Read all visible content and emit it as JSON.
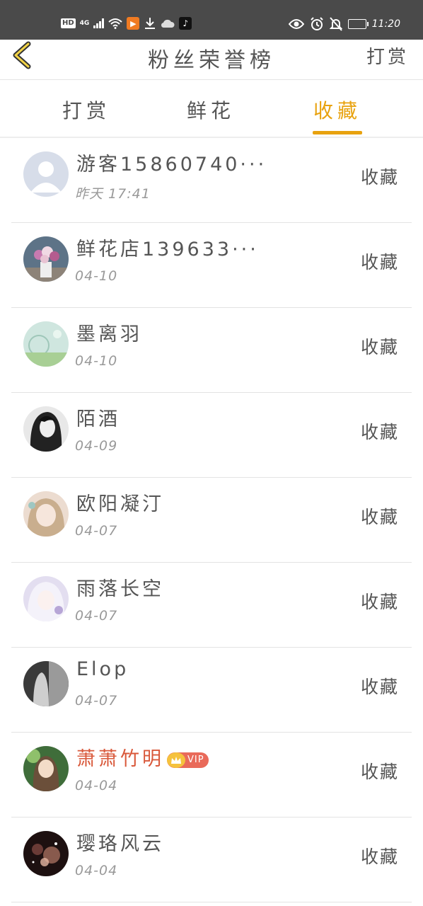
{
  "status_bar": {
    "hd": "HD",
    "network": "4G",
    "time": "11:20"
  },
  "header": {
    "title": "粉丝荣誉榜",
    "action_label": "打赏"
  },
  "tabs": [
    {
      "label": "打赏",
      "active": false
    },
    {
      "label": "鲜花",
      "active": false
    },
    {
      "label": "收藏",
      "active": true
    }
  ],
  "list": [
    {
      "name": "游客15860740···",
      "date": "昨天 17:41",
      "action": "收藏",
      "avatar": "default-user"
    },
    {
      "name": "鲜花店139633···",
      "date": "04-10",
      "action": "收藏",
      "avatar": "flowers"
    },
    {
      "name": "墨离羽",
      "date": "04-10",
      "action": "收藏",
      "avatar": "garden"
    },
    {
      "name": "陌酒",
      "date": "04-09",
      "action": "收藏",
      "avatar": "girl-dark"
    },
    {
      "name": "欧阳凝汀",
      "date": "04-07",
      "action": "收藏",
      "avatar": "anime-girl"
    },
    {
      "name": "雨落长空",
      "date": "04-07",
      "action": "收藏",
      "avatar": "anime-white"
    },
    {
      "name": "Elop",
      "date": "04-07",
      "action": "收藏",
      "avatar": "gray-figure"
    },
    {
      "name": "萧萧竹明",
      "date": "04-04",
      "action": "收藏",
      "avatar": "green-girl",
      "vip": "VIP"
    },
    {
      "name": "璎珞风云",
      "date": "04-04",
      "action": "收藏",
      "avatar": "dark-sparkle"
    }
  ],
  "colors": {
    "accent": "#e8a20f",
    "vip_name": "#d9593b",
    "status_bar": "#4a4a4a"
  }
}
